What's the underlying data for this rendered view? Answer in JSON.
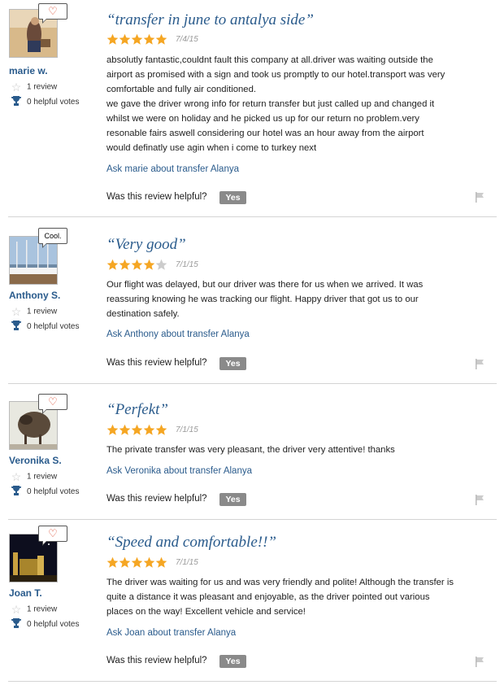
{
  "reviews": [
    {
      "username": "marie w.",
      "badge": "heart",
      "reviews_count": "1 review",
      "helpful_votes": "0 helpful votes",
      "title": "“transfer in june to antalya side”",
      "rating": 5,
      "date": "7/4/15",
      "body_lines": [
        "absolutly fantastic,couldnt fault this company at all.driver was waiting outside the",
        "airport as promised with a sign and took us promptly to our hotel.transport was very",
        "comfortable and fully air conditioned.",
        "we gave the driver wrong info for return transfer but just called up and changed it",
        "whilst we were on holiday and he picked us up for our return no problem.very",
        "resonable fairs aswell considering our hotel was an hour away from the airport",
        "would definatly use agin when i come to turkey next"
      ],
      "ask_link": "Ask marie about transfer Alanya",
      "helpful_question": "Was this review helpful?",
      "yes_label": "Yes"
    },
    {
      "username": "Anthony S.",
      "badge": "Cool.",
      "reviews_count": "1 review",
      "helpful_votes": "0 helpful votes",
      "title": "“Very good”",
      "rating": 4,
      "date": "7/1/15",
      "body_lines": [
        "Our flight was delayed, but our driver was there for us when we arrived. It was",
        "reassuring knowing he was tracking our flight. Happy driver that got us to our",
        "destination safely."
      ],
      "ask_link": "Ask Anthony about transfer Alanya",
      "helpful_question": "Was this review helpful?",
      "yes_label": "Yes"
    },
    {
      "username": "Veronika S.",
      "badge": "heart",
      "reviews_count": "1 review",
      "helpful_votes": "0 helpful votes",
      "title": "“Perfekt”",
      "rating": 5,
      "date": "7/1/15",
      "body_lines": [
        "The private transfer was very pleasant, the driver very attentive! thanks"
      ],
      "ask_link": "Ask Veronika about transfer Alanya",
      "helpful_question": "Was this review helpful?",
      "yes_label": "Yes"
    },
    {
      "username": "Joan T.",
      "badge": "heart",
      "reviews_count": "1 review",
      "helpful_votes": "0 helpful votes",
      "title": "“Speed and comfortable!!”",
      "rating": 5,
      "date": "7/1/15",
      "body_lines": [
        "The driver was waiting for us and was very friendly and polite! Although the transfer is",
        "quite a distance it was pleasant and enjoyable, as the driver pointed out various",
        "places on the way! Excellent vehicle and service!"
      ],
      "ask_link": "Ask Joan about transfer Alanya",
      "helpful_question": "Was this review helpful?",
      "yes_label": "Yes"
    }
  ],
  "colors": {
    "link": "#2a5b8c",
    "star_filled": "#f5a623",
    "star_empty": "#cccccc",
    "yes_button": "#8a8a8a",
    "heart": "#d9452b"
  }
}
